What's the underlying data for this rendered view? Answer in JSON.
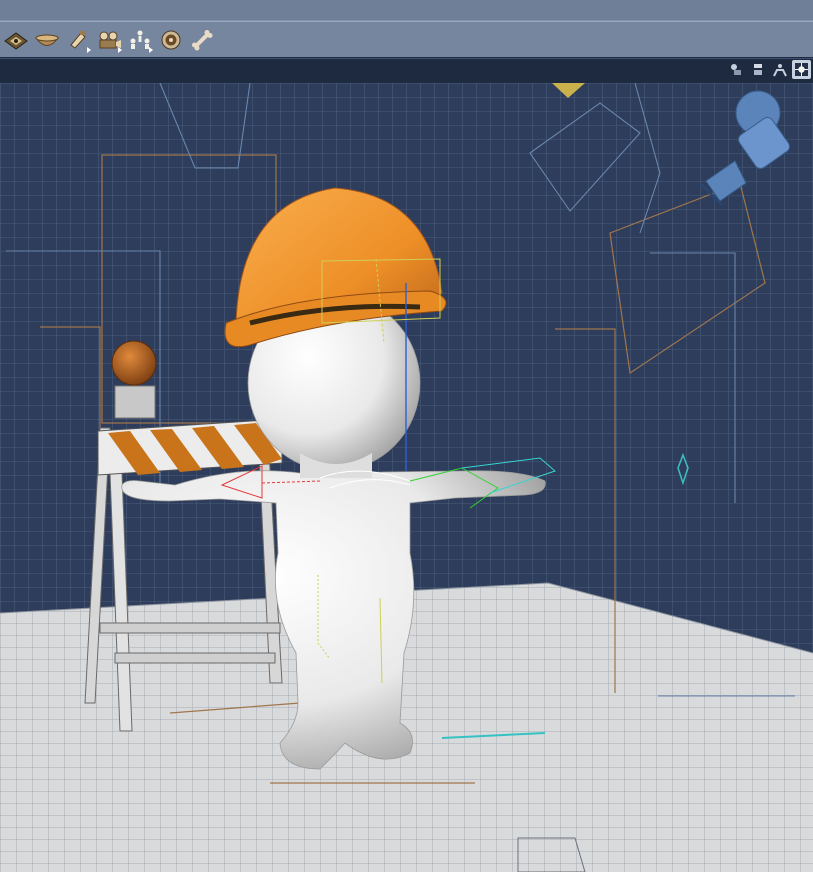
{
  "toolbar": {
    "tools": [
      {
        "name": "view-magnifier-icon"
      },
      {
        "name": "bowl-icon"
      },
      {
        "name": "light-icon"
      },
      {
        "name": "camera-icon"
      },
      {
        "name": "figure-group-icon"
      },
      {
        "name": "target-icon"
      },
      {
        "name": "bone-icon"
      }
    ]
  },
  "viewport": {
    "icons": [
      "figure-icon",
      "camera-stack-icon",
      "walk-icon",
      "grid-view-icon"
    ],
    "background_color": "#2d3d5b",
    "grid_color": "#5d6e8e",
    "floor_color": "#d8dadc"
  },
  "colors": {
    "helmet": "#f0962f",
    "barricade_stripe": "#c9741a",
    "figure": "#f3f3f3"
  }
}
